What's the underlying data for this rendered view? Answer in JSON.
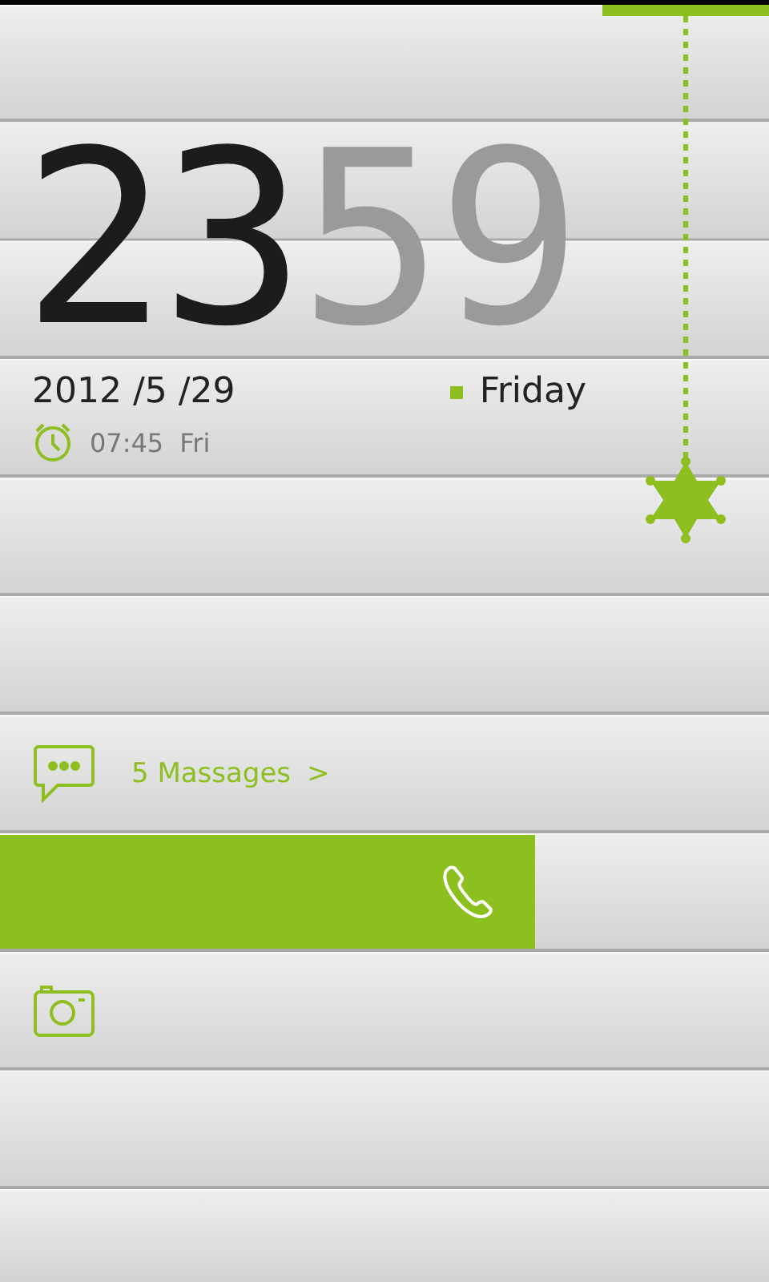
{
  "clock": {
    "hours": "23",
    "minutes": "59"
  },
  "date": "2012 /5 /29",
  "weekday": {
    "label": "Friday",
    "color": "#8cbf1f"
  },
  "alarm": {
    "time": "07:45",
    "day": "Fri"
  },
  "messages": {
    "text": "5 Massages",
    "arrow": ">"
  },
  "call_slider": {
    "level": 0.696
  }
}
